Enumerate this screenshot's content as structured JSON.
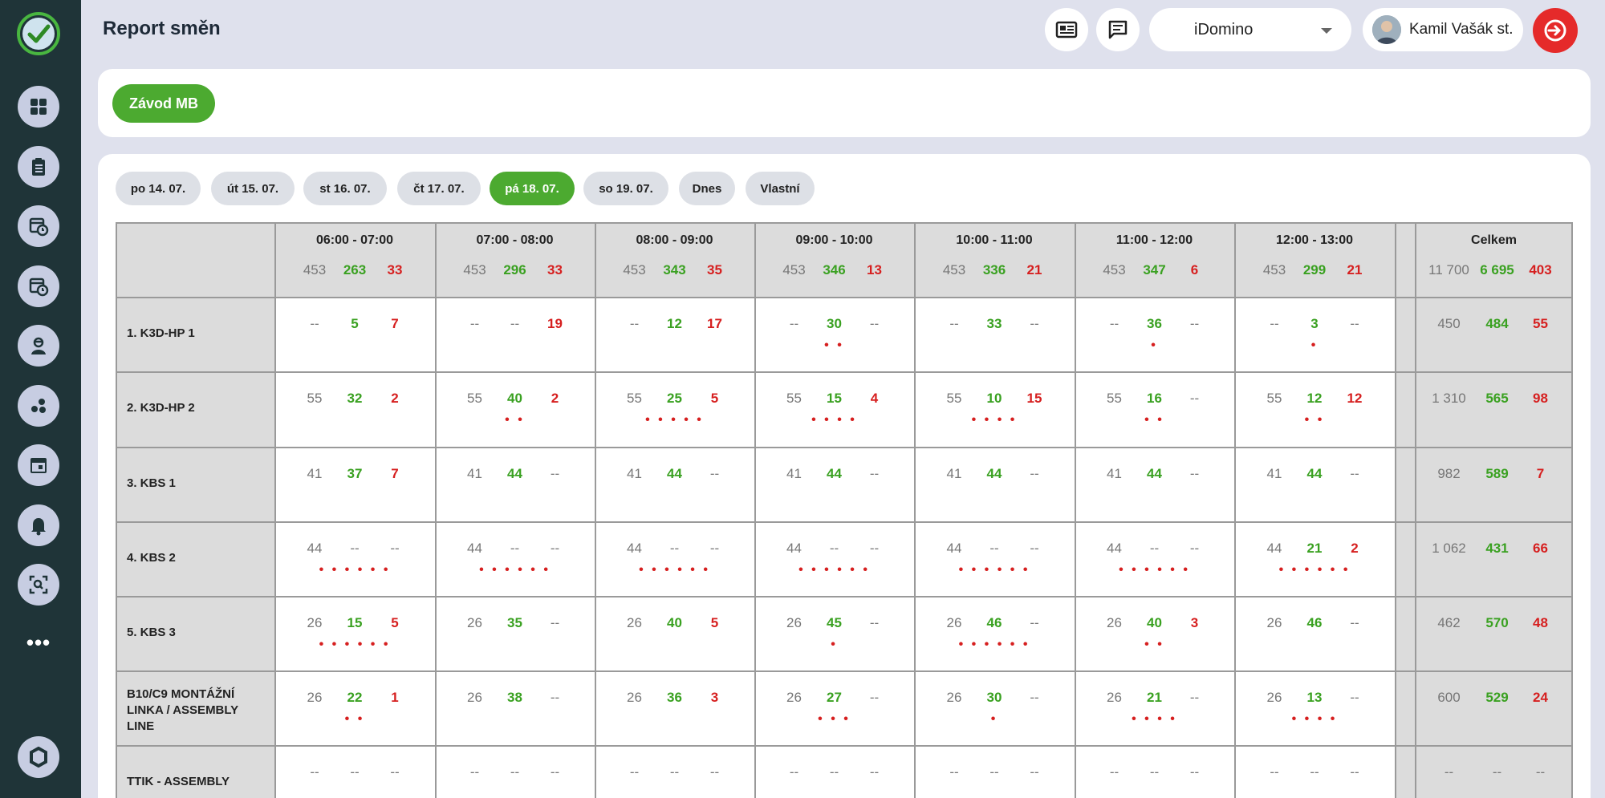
{
  "header": {
    "title": "Report směn"
  },
  "company_select": {
    "selected": "iDomino"
  },
  "user": {
    "name": "Kamil Vašák st."
  },
  "sidebar": {
    "icons": [
      "dashboard-icon",
      "clipboard-list-icon",
      "calendar-clock-icon",
      "schedule-icon",
      "worker-icon",
      "dots-cluster-icon",
      "calendar-icon",
      "bell-icon",
      "scan-icon"
    ],
    "more": "•••"
  },
  "plant": {
    "label": "Závod MB"
  },
  "day_tabs": [
    {
      "label": "po 14. 07.",
      "active": false
    },
    {
      "label": "út 15. 07.",
      "active": false
    },
    {
      "label": "st 16. 07.",
      "active": false
    },
    {
      "label": "čt 17. 07.",
      "active": false
    },
    {
      "label": "pá 18. 07.",
      "active": true
    },
    {
      "label": "so 19. 07.",
      "active": false
    },
    {
      "label": "Dnes",
      "active": false
    },
    {
      "label": "Vlastní",
      "active": false
    }
  ],
  "table": {
    "columns": [
      {
        "label": "06:00 - 07:00",
        "plan": "453",
        "good": "263",
        "bad": "33"
      },
      {
        "label": "07:00 - 08:00",
        "plan": "453",
        "good": "296",
        "bad": "33"
      },
      {
        "label": "08:00 - 09:00",
        "plan": "453",
        "good": "343",
        "bad": "35"
      },
      {
        "label": "09:00 - 10:00",
        "plan": "453",
        "good": "346",
        "bad": "13"
      },
      {
        "label": "10:00 - 11:00",
        "plan": "453",
        "good": "336",
        "bad": "21"
      },
      {
        "label": "11:00 - 12:00",
        "plan": "453",
        "good": "347",
        "bad": "6"
      },
      {
        "label": "12:00 - 13:00",
        "plan": "453",
        "good": "299",
        "bad": "21"
      }
    ],
    "total": {
      "label": "Celkem",
      "plan": "11 700",
      "good": "6 695",
      "bad": "403"
    },
    "rows": [
      {
        "label": "1. K3D-HP 1",
        "cells": [
          [
            "--",
            "5",
            "7",
            ""
          ],
          [
            "--",
            "--",
            "19",
            ""
          ],
          [
            "--",
            "12",
            "17",
            ""
          ],
          [
            "--",
            "30",
            "--",
            "• •"
          ],
          [
            "--",
            "33",
            "--",
            ""
          ],
          [
            "--",
            "36",
            "--",
            "•"
          ],
          [
            "--",
            "3",
            "--",
            "•"
          ]
        ],
        "total": [
          "450",
          "484",
          "55"
        ]
      },
      {
        "label": "2. K3D-HP 2",
        "cells": [
          [
            "55",
            "32",
            "2",
            ""
          ],
          [
            "55",
            "40",
            "2",
            "• •"
          ],
          [
            "55",
            "25",
            "5",
            "• • • • •"
          ],
          [
            "55",
            "15",
            "4",
            "• • • •"
          ],
          [
            "55",
            "10",
            "15",
            "• • • •"
          ],
          [
            "55",
            "16",
            "--",
            "• •"
          ],
          [
            "55",
            "12",
            "12",
            "• •"
          ]
        ],
        "total": [
          "1 310",
          "565",
          "98"
        ]
      },
      {
        "label": "3. KBS 1",
        "cells": [
          [
            "41",
            "37",
            "7",
            ""
          ],
          [
            "41",
            "44",
            "--",
            ""
          ],
          [
            "41",
            "44",
            "--",
            ""
          ],
          [
            "41",
            "44",
            "--",
            ""
          ],
          [
            "41",
            "44",
            "--",
            ""
          ],
          [
            "41",
            "44",
            "--",
            ""
          ],
          [
            "41",
            "44",
            "--",
            ""
          ]
        ],
        "total": [
          "982",
          "589",
          "7"
        ]
      },
      {
        "label": "4. KBS 2",
        "cells": [
          [
            "44",
            "--",
            "--",
            "• • • • • •"
          ],
          [
            "44",
            "--",
            "--",
            "• • • • • •"
          ],
          [
            "44",
            "--",
            "--",
            "• • • • • •"
          ],
          [
            "44",
            "--",
            "--",
            "• • • • • •"
          ],
          [
            "44",
            "--",
            "--",
            "• • • • • •"
          ],
          [
            "44",
            "--",
            "--",
            "• • • • • •"
          ],
          [
            "44",
            "21",
            "2",
            "• • • • • •"
          ]
        ],
        "total": [
          "1 062",
          "431",
          "66"
        ]
      },
      {
        "label": "5. KBS 3",
        "cells": [
          [
            "26",
            "15",
            "5",
            "• • • • • •"
          ],
          [
            "26",
            "35",
            "--",
            ""
          ],
          [
            "26",
            "40",
            "5",
            ""
          ],
          [
            "26",
            "45",
            "--",
            "•"
          ],
          [
            "26",
            "46",
            "--",
            "• • • • • •"
          ],
          [
            "26",
            "40",
            "3",
            "• •"
          ],
          [
            "26",
            "46",
            "--",
            ""
          ]
        ],
        "total": [
          "462",
          "570",
          "48"
        ]
      },
      {
        "label": "B10/C9 MONTÁŽNÍ LINKA / ASSEMBLY LINE",
        "cells": [
          [
            "26",
            "22",
            "1",
            "• •"
          ],
          [
            "26",
            "38",
            "--",
            ""
          ],
          [
            "26",
            "36",
            "3",
            ""
          ],
          [
            "26",
            "27",
            "--",
            "• • •"
          ],
          [
            "26",
            "30",
            "--",
            "•"
          ],
          [
            "26",
            "21",
            "--",
            "• • • •"
          ],
          [
            "26",
            "13",
            "--",
            "• • • •"
          ]
        ],
        "total": [
          "600",
          "529",
          "24"
        ]
      },
      {
        "label": "TTIK - ASSEMBLY",
        "cells": [
          [
            "--",
            "--",
            "--",
            ""
          ],
          [
            "--",
            "--",
            "--",
            ""
          ],
          [
            "--",
            "--",
            "--",
            ""
          ],
          [
            "--",
            "--",
            "--",
            ""
          ],
          [
            "--",
            "--",
            "--",
            ""
          ],
          [
            "--",
            "--",
            "--",
            ""
          ],
          [
            "--",
            "--",
            "--",
            ""
          ]
        ],
        "total": [
          "--",
          "--",
          "--"
        ]
      }
    ]
  }
}
